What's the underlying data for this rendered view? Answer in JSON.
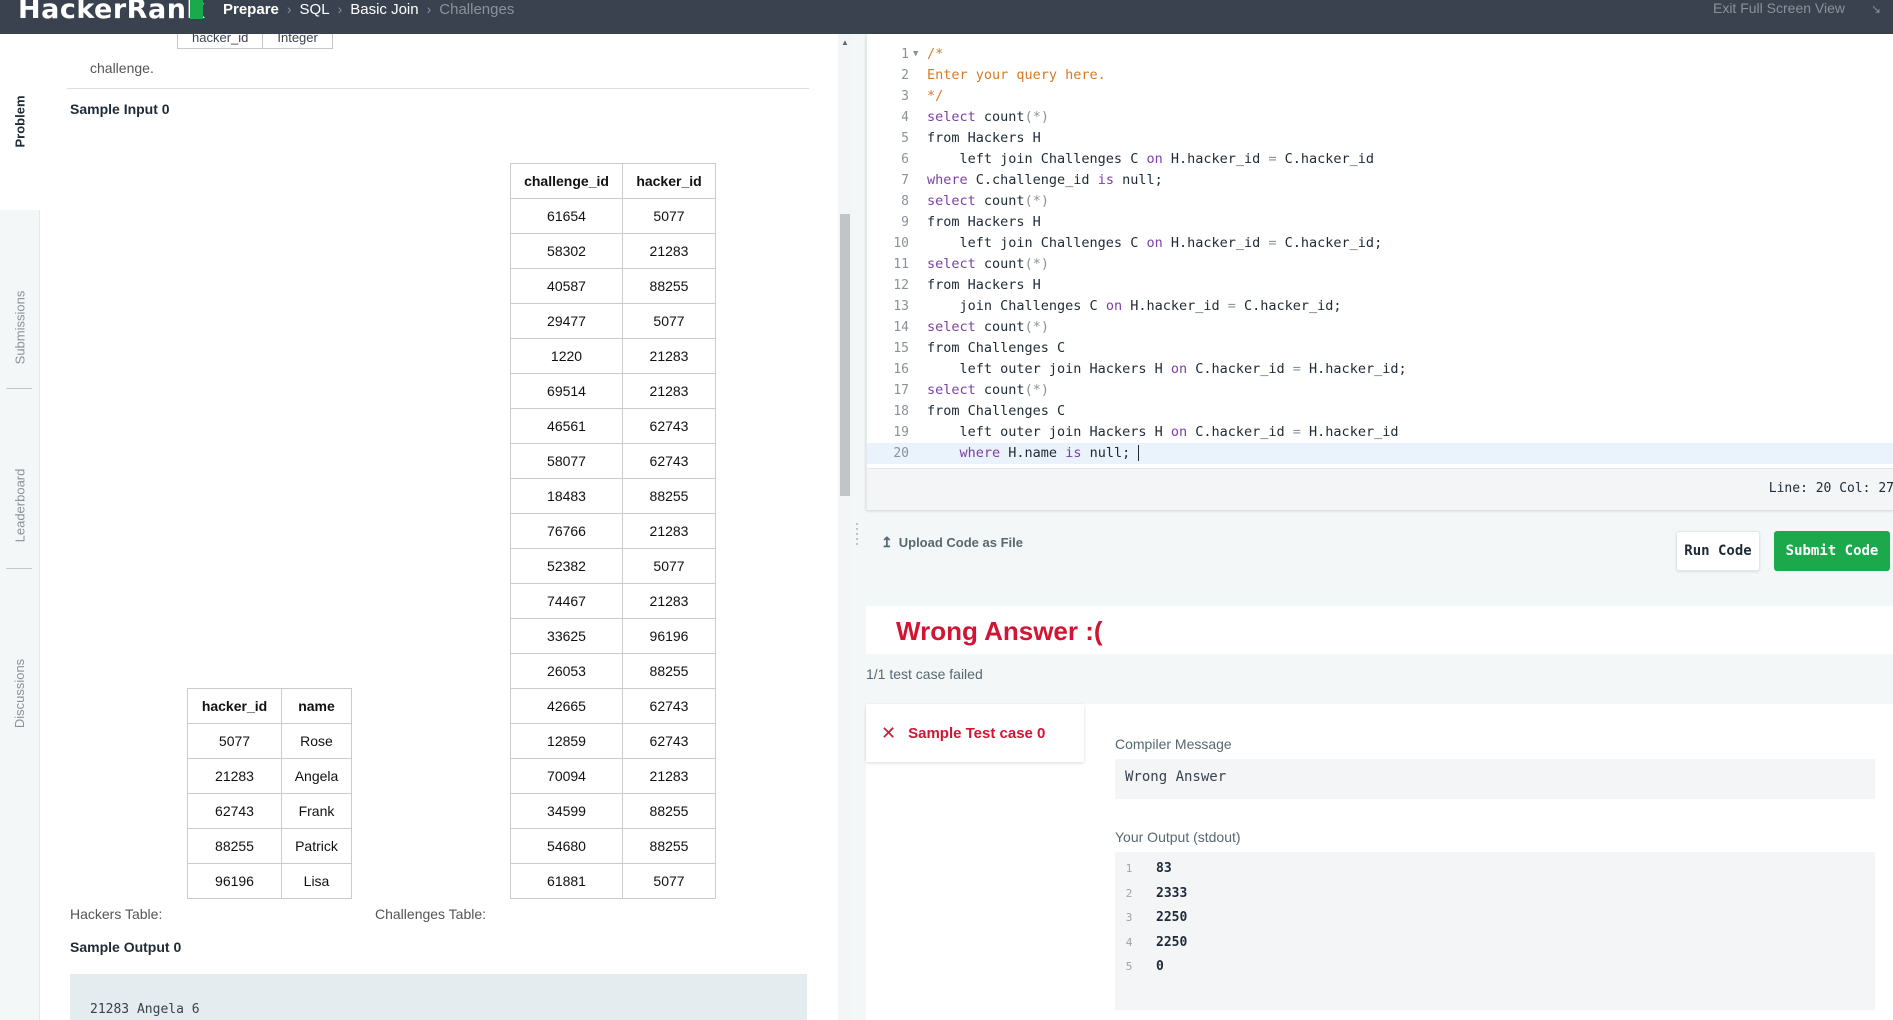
{
  "header": {
    "logo": "HackerRank",
    "breadcrumb": [
      "Prepare",
      "SQL",
      "Basic Join",
      "Challenges"
    ],
    "exit_fullscreen": "Exit Full Screen View"
  },
  "side_tabs": [
    "Problem",
    "Submissions",
    "Leaderboard",
    "Discussions"
  ],
  "problem": {
    "top_table_cells": [
      "hacker_id",
      "Integer"
    ],
    "challenge_word": "challenge.",
    "sample_input_heading": "Sample Input 0",
    "challenges_table": {
      "headers": [
        "challenge_id",
        "hacker_id"
      ],
      "rows": [
        [
          "61654",
          "5077"
        ],
        [
          "58302",
          "21283"
        ],
        [
          "40587",
          "88255"
        ],
        [
          "29477",
          "5077"
        ],
        [
          "1220",
          "21283"
        ],
        [
          "69514",
          "21283"
        ],
        [
          "46561",
          "62743"
        ],
        [
          "58077",
          "62743"
        ],
        [
          "18483",
          "88255"
        ],
        [
          "76766",
          "21283"
        ],
        [
          "52382",
          "5077"
        ],
        [
          "74467",
          "21283"
        ],
        [
          "33625",
          "96196"
        ],
        [
          "26053",
          "88255"
        ],
        [
          "42665",
          "62743"
        ],
        [
          "12859",
          "62743"
        ],
        [
          "70094",
          "21283"
        ],
        [
          "34599",
          "88255"
        ],
        [
          "54680",
          "88255"
        ],
        [
          "61881",
          "5077"
        ]
      ]
    },
    "hackers_table": {
      "headers": [
        "hacker_id",
        "name"
      ],
      "rows": [
        [
          "5077",
          "Rose"
        ],
        [
          "21283",
          "Angela"
        ],
        [
          "62743",
          "Frank"
        ],
        [
          "88255",
          "Patrick"
        ],
        [
          "96196",
          "Lisa"
        ]
      ]
    },
    "hackers_caption": "Hackers Table:",
    "challenges_caption": "Challenges Table:",
    "sample_output_heading": "Sample Output 0",
    "sample_output_text": "21283 Angela 6"
  },
  "editor": {
    "lines": [
      "/*",
      "Enter your query here.",
      "*/",
      "select count(*)",
      "from Hackers H",
      "    left join Challenges C on H.hacker_id = C.hacker_id",
      "where C.challenge_id is null;",
      "select count(*)",
      "from Hackers H",
      "    left join Challenges C on H.hacker_id = C.hacker_id;",
      "select count(*)",
      "from Hackers H",
      "    join Challenges C on H.hacker_id = C.hacker_id;",
      "select count(*)",
      "from Challenges C",
      "    left outer join Hackers H on C.hacker_id = H.hacker_id;",
      "select count(*)",
      "from Challenges C",
      "    left outer join Hackers H on C.hacker_id = H.hacker_id",
      "    where H.name is null;"
    ],
    "status": "Line: 20 Col: 27"
  },
  "actions": {
    "upload": "Upload Code as File",
    "run": "Run Code",
    "submit": "Submit Code"
  },
  "result": {
    "title": "Wrong Answer :(",
    "summary": "1/1 test case failed",
    "testcase_label": "Sample Test case 0",
    "compiler_label": "Compiler Message",
    "compiler_message": "Wrong Answer",
    "output_label": "Your Output (stdout)",
    "output_lines": [
      "83",
      "2333",
      "2250",
      "2250",
      "0"
    ]
  },
  "colors": {
    "header_bg": "#39424e",
    "brand_green": "#1ba94c",
    "error_red": "#d11534"
  }
}
